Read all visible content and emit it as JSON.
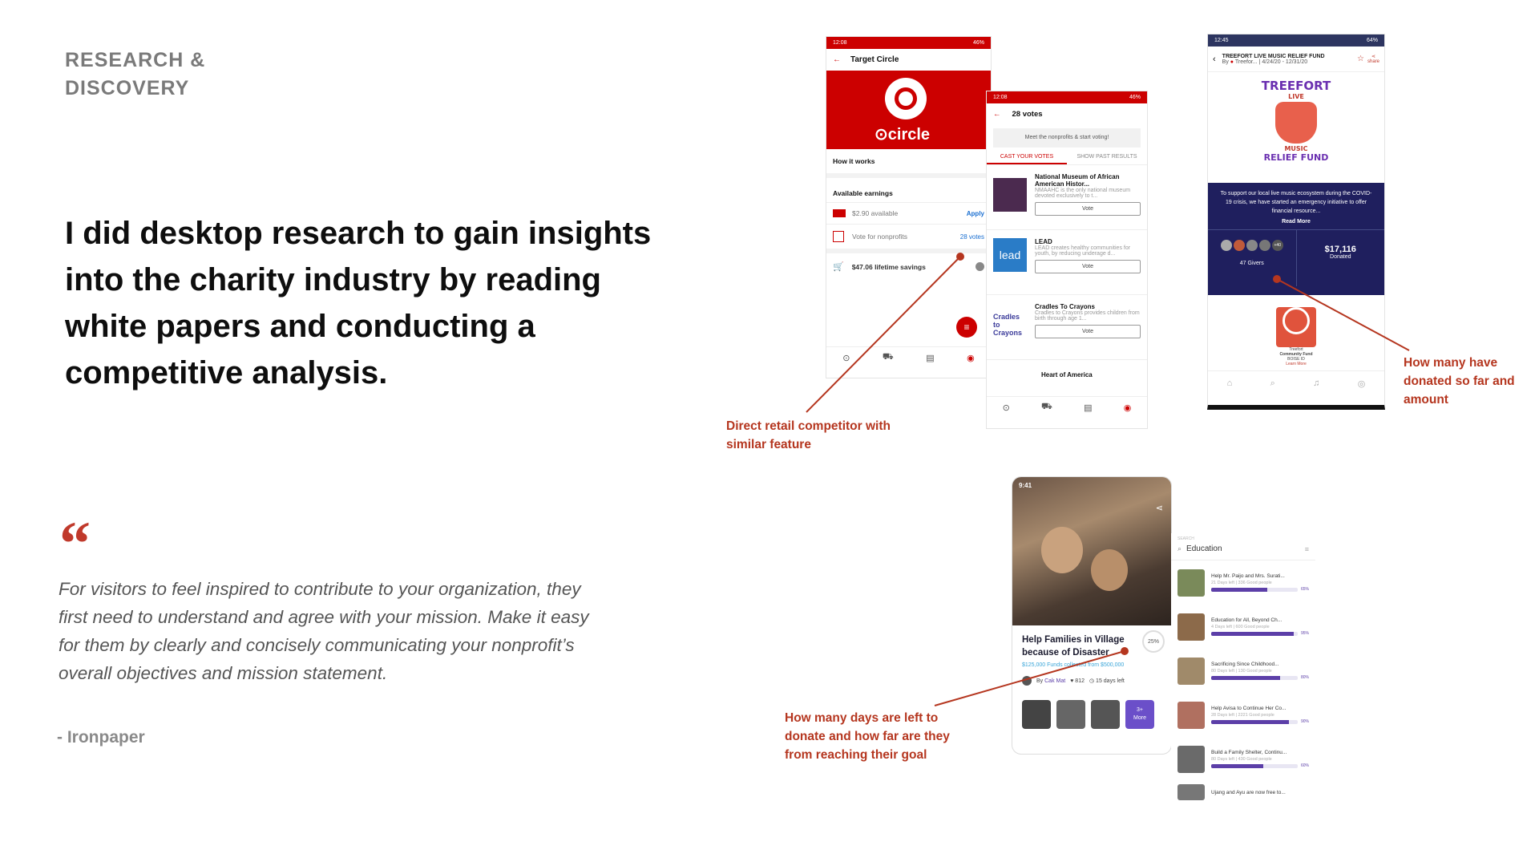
{
  "section_label": [
    "RESEARCH &",
    "DISCOVERY"
  ],
  "headline": "I did desktop research to gain insights into the charity industry by reading white papers and conducting a competitive analysis.",
  "quote": {
    "mark": "“",
    "text": "For visitors to feel inspired to contribute to your organization, they first need to understand and agree with your mission. Make it easy for them by clearly and concisely communicating your nonprofit’s overall objectives and mission statement.",
    "author": "- Ironpaper"
  },
  "colors": {
    "accent": "#b5361f",
    "target_red": "#cc0000",
    "treefort_navy": "#1f1f5e",
    "progress_purple": "#5c3fa8"
  },
  "annotations": {
    "retail": [
      "Direct retail competitor with",
      "similar feature"
    ],
    "donated": [
      "How many have",
      "donated so far and",
      "amount"
    ],
    "days": [
      "How many days are left to",
      "donate and how far are they",
      "from reaching their goal"
    ]
  },
  "target_phone": {
    "time": "12:08",
    "battery": "46%",
    "title": "Target Circle",
    "logo_text": "circle",
    "how_it_works": "How it works",
    "earnings_title": "Available earnings",
    "earning_amount": "$2.90 available",
    "apply": "Apply",
    "vote_label": "Vote for nonprofits",
    "votes_link": "28 votes",
    "savings": "$47.06 lifetime savings"
  },
  "votes_phone": {
    "time": "12:08",
    "battery": "46%",
    "title": "28 votes",
    "banner": "Meet the nonprofits & start voting!",
    "tab_active": "CAST YOUR VOTES",
    "tab_other": "SHOW PAST RESULTS",
    "vote_label": "Vote",
    "orgs": [
      {
        "name": "National Museum of African American Histor...",
        "desc": "NMAAHC is the only national museum devoted exclusively to t..."
      },
      {
        "name": "LEAD",
        "desc": "LEAD creates healthy communities for youth, by reducing underage d..."
      },
      {
        "name": "Cradles To Crayons",
        "desc": "Cradles to Crayons provides children from birth through age 1..."
      }
    ],
    "next_org": "Heart of America",
    "logo_lead": "lead",
    "logo_cradles": "Cradles to Crayons"
  },
  "treefort_phone": {
    "time": "12:45",
    "battery": "64%",
    "title": "TREEFORT LIVE MUSIC RELIEF FUND",
    "by": "By",
    "org": "Treefor...",
    "dates": "4/24/20 - 12/31/20",
    "share": "share",
    "logo_lines": [
      "TREEFORT",
      "LIVE",
      "MUSIC",
      "RELIEF FUND"
    ],
    "description": "To support our local live music ecosystem during the COVID-19 crisis, we have started an emergency initiative to offer financial resource...",
    "read_more": "Read More",
    "more_givers": "+40",
    "givers": "47 Givers",
    "amount": "$17,116",
    "amount_label": "Donated",
    "community_lines": [
      "Treefort",
      "Community Fund",
      "BOISE ID"
    ],
    "learn_more": "Learn More"
  },
  "village_phone": {
    "time": "9:41",
    "title": "Help Families in Village because of Disaster",
    "progress": "25%",
    "progress_value": 0.25,
    "funds": "$125,000 Funds collected from $500,000",
    "by": "By",
    "author": "Cak Mat",
    "likes": "812",
    "days_left": "15 days left",
    "more": [
      "3+",
      "More"
    ]
  },
  "education_list": {
    "search_label": "SEARCH",
    "query": "Education",
    "items": [
      {
        "title": "Help Mr. Paijo and Mrs. Surati...",
        "meta": "21 Days left | 336 Good people",
        "pct": "65%",
        "fill": 0.65
      },
      {
        "title": "Education for All, Beyond Ch...",
        "meta": "4 Days left | 600 Good people",
        "pct": "95%",
        "fill": 0.95
      },
      {
        "title": "Sacrificing Since Childhood...",
        "meta": "80 Days left | 130 Good people",
        "pct": "80%",
        "fill": 0.8
      },
      {
        "title": "Help Avisa to Continue Her Co...",
        "meta": "28 Days left | 2221 Good people",
        "pct": "90%",
        "fill": 0.9
      },
      {
        "title": "Build a Family Shelter, Continu...",
        "meta": "80 Days left | 430 Good people",
        "pct": "60%",
        "fill": 0.6
      }
    ],
    "last_item": "Ujang and Ayu are now free to..."
  }
}
